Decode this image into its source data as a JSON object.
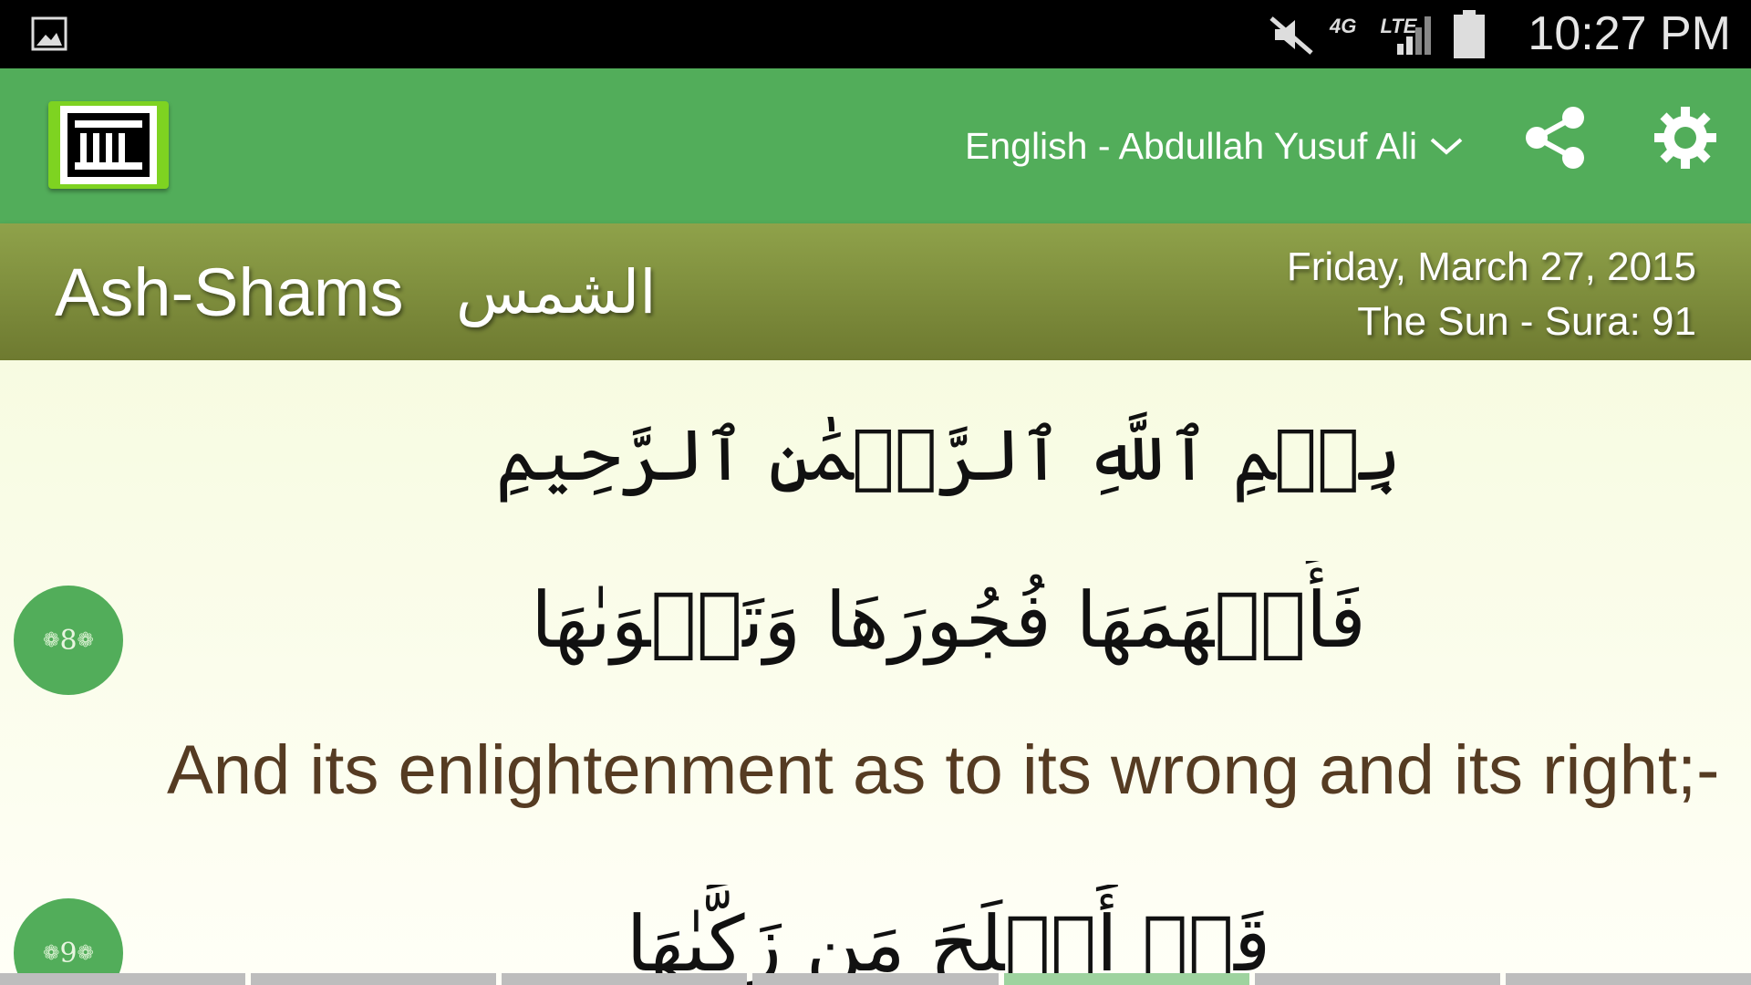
{
  "status_bar": {
    "time": "10:27 PM",
    "network": "4G LTE",
    "icons": [
      "gallery-notification-icon",
      "mute-icon",
      "network-4g-lte-icon",
      "signal-icon",
      "battery-icon"
    ]
  },
  "app_bar": {
    "translation_label": "English - Abdullah Yusuf Ali",
    "icons": [
      "app-logo",
      "chevron-down-icon",
      "share-icon",
      "gear-icon"
    ],
    "accent_color": "#52ad5a"
  },
  "sura": {
    "name": "Ash-Shams",
    "name_arabic": "الشمس",
    "date": "Friday, March 27, 2015",
    "meta": "The Sun - Sura: 91",
    "header_color": "#7f8f3c"
  },
  "content": {
    "bismillah": "بِسۡمِ ٱللَّهِ ٱلرَّحۡمَٰنِ ٱلرَّحِيمِ",
    "verses": [
      {
        "number": "8",
        "arabic": "فَأَلۡهَمَهَا فُجُورَهَا وَتَقۡوَىٰهَا",
        "translation": "And its enlightenment as to its wrong and its right;-"
      },
      {
        "number": "9",
        "arabic": "قَدۡ أَفۡلَحَ مَن زَكَّىٰهَا",
        "translation": ""
      }
    ],
    "translation_color": "#553b22"
  },
  "page_indicator": {
    "total": 7,
    "current": 5
  }
}
